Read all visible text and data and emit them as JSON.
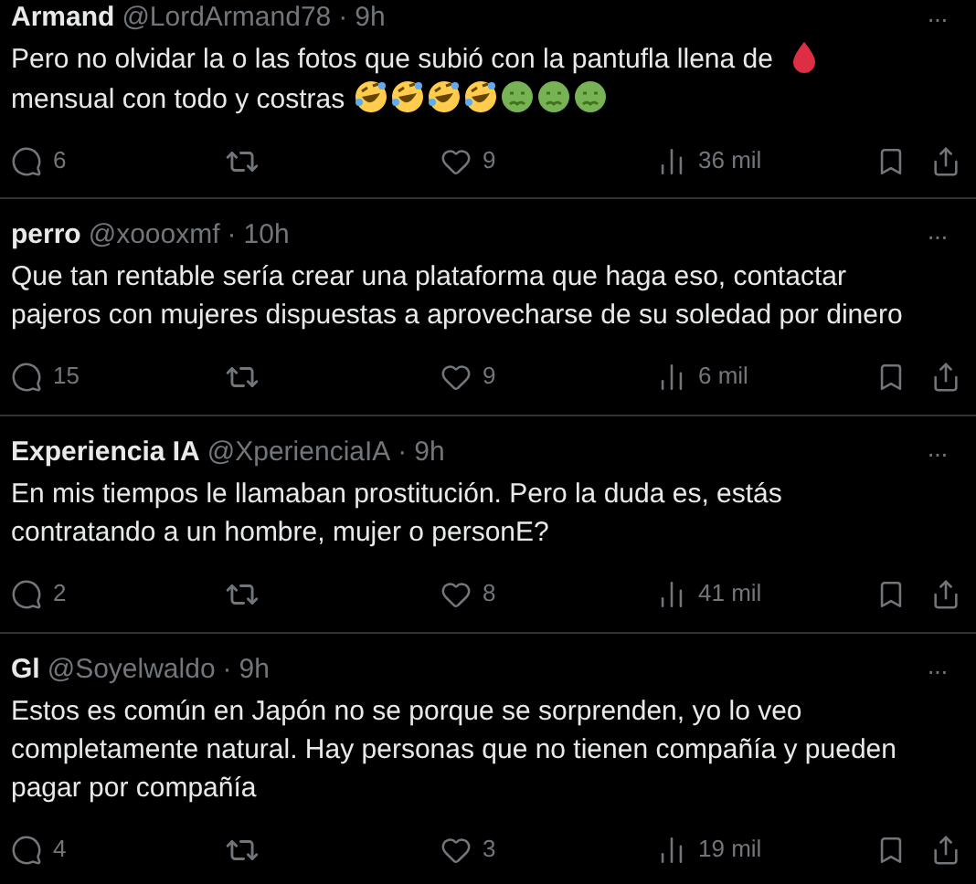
{
  "replies": [
    {
      "name": "Armand",
      "handle": "@LordArmand78",
      "sep": "·",
      "time": "9h",
      "more": "···",
      "body": [
        {
          "kind": "text",
          "text": "Pero no olvidar la  o las fotos que subió con la pantufla llena de"
        },
        {
          "kind": "blood-drop"
        },
        {
          "kind": "text",
          "text": "mensual"
        },
        {
          "kind": "text",
          "text": "con todo y costras"
        },
        {
          "kind": "laughing-face"
        },
        {
          "kind": "laughing-face"
        },
        {
          "kind": "laughing-face"
        },
        {
          "kind": "laughing-face"
        },
        {
          "kind": "nauseated-face"
        },
        {
          "kind": "nauseated-face"
        },
        {
          "kind": "nauseated-face"
        }
      ],
      "replies": "6",
      "likes": "9",
      "views": "36 mil"
    },
    {
      "name": "perro",
      "handle": "@xoooxmf",
      "sep": "·",
      "time": "10h",
      "more": "···",
      "body": [
        {
          "kind": "text",
          "text": "Que tan rentable sería crear una plataforma que haga eso, contactar pajeros con mujeres dispuestas a aprovecharse de su soledad por dinero"
        }
      ],
      "replies": "15",
      "likes": "9",
      "views": "6 mil"
    },
    {
      "name": "Experiencia IA",
      "handle": "@XperienciaIA",
      "sep": "·",
      "time": "9h",
      "more": "···",
      "body": [
        {
          "kind": "text",
          "text": "En mis tiempos le llamaban prostitución. Pero la duda es, estás contratando a un hombre, mujer o personE?"
        }
      ],
      "replies": "2",
      "likes": "8",
      "views": "41 mil"
    },
    {
      "name": "Gl",
      "handle": "@Soyelwaldo",
      "sep": "·",
      "time": "9h",
      "more": "···",
      "body": [
        {
          "kind": "text",
          "text": "Estos es común en Japón no se porque se sorprenden, yo lo veo completamente natural. Hay personas que no tienen compañía y pueden pagar por compañía"
        }
      ],
      "replies": "4",
      "likes": "3",
      "views": "19 mil"
    }
  ]
}
